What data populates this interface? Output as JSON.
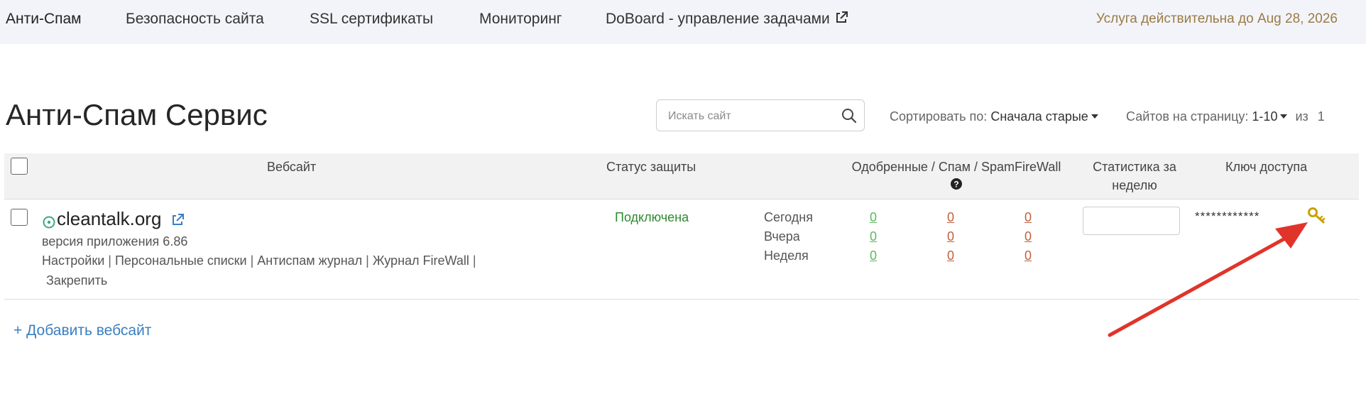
{
  "nav": {
    "items": [
      {
        "label": "Анти-Спам"
      },
      {
        "label": "Безопасность сайта"
      },
      {
        "label": "SSL сертификаты"
      },
      {
        "label": "Мониторинг"
      },
      {
        "label": "DoBoard - управление задачами"
      }
    ],
    "service_until": "Услуга действительна до Aug 28, 2026"
  },
  "page": {
    "title": "Анти-Спам Сервис"
  },
  "search": {
    "placeholder": "Искать сайт"
  },
  "sort": {
    "label": "Сортировать по:",
    "value": "Сначала старые"
  },
  "per_page": {
    "label": "Сайтов на страницу:",
    "value": "1-10",
    "of_label": "из",
    "total": "1"
  },
  "table": {
    "headers": {
      "website": "Вебсайт",
      "status": "Статус защиты",
      "counts": "Одобренные / Спам / SpamFireWall",
      "week_stats_line1": "Статистика за",
      "week_stats_line2": "неделю",
      "access_key": "Ключ доступа"
    },
    "rows": [
      {
        "site": "cleantalk.org",
        "app_version": "версия приложения 6.86",
        "links": [
          "Настройки",
          "Персональные списки",
          "Антиспам журнал",
          "Журнал FireWall"
        ],
        "pin": "Закрепить",
        "status": "Подключена",
        "periods": [
          {
            "label": "Сегодня",
            "approved": "0",
            "spam": "0",
            "sfw": "0"
          },
          {
            "label": "Вчера",
            "approved": "0",
            "spam": "0",
            "sfw": "0"
          },
          {
            "label": "Неделя",
            "approved": "0",
            "spam": "0",
            "sfw": "0"
          }
        ],
        "access_key_masked": "************"
      }
    ]
  },
  "add_site": "+ Добавить вебсайт",
  "colors": {
    "nav_bg": "#f3f4f9",
    "service_until": "#9a7b46",
    "status_ok": "#2f8a2f",
    "approved": "#5cb85c",
    "spam": "#c0603a",
    "link": "#3a7fc1",
    "key_icon": "#c9a100",
    "annotation_arrow": "#e0342b"
  },
  "icons": [
    "external-link-icon",
    "search-icon",
    "question-circle-icon",
    "site-status-icon",
    "key-icon"
  ]
}
